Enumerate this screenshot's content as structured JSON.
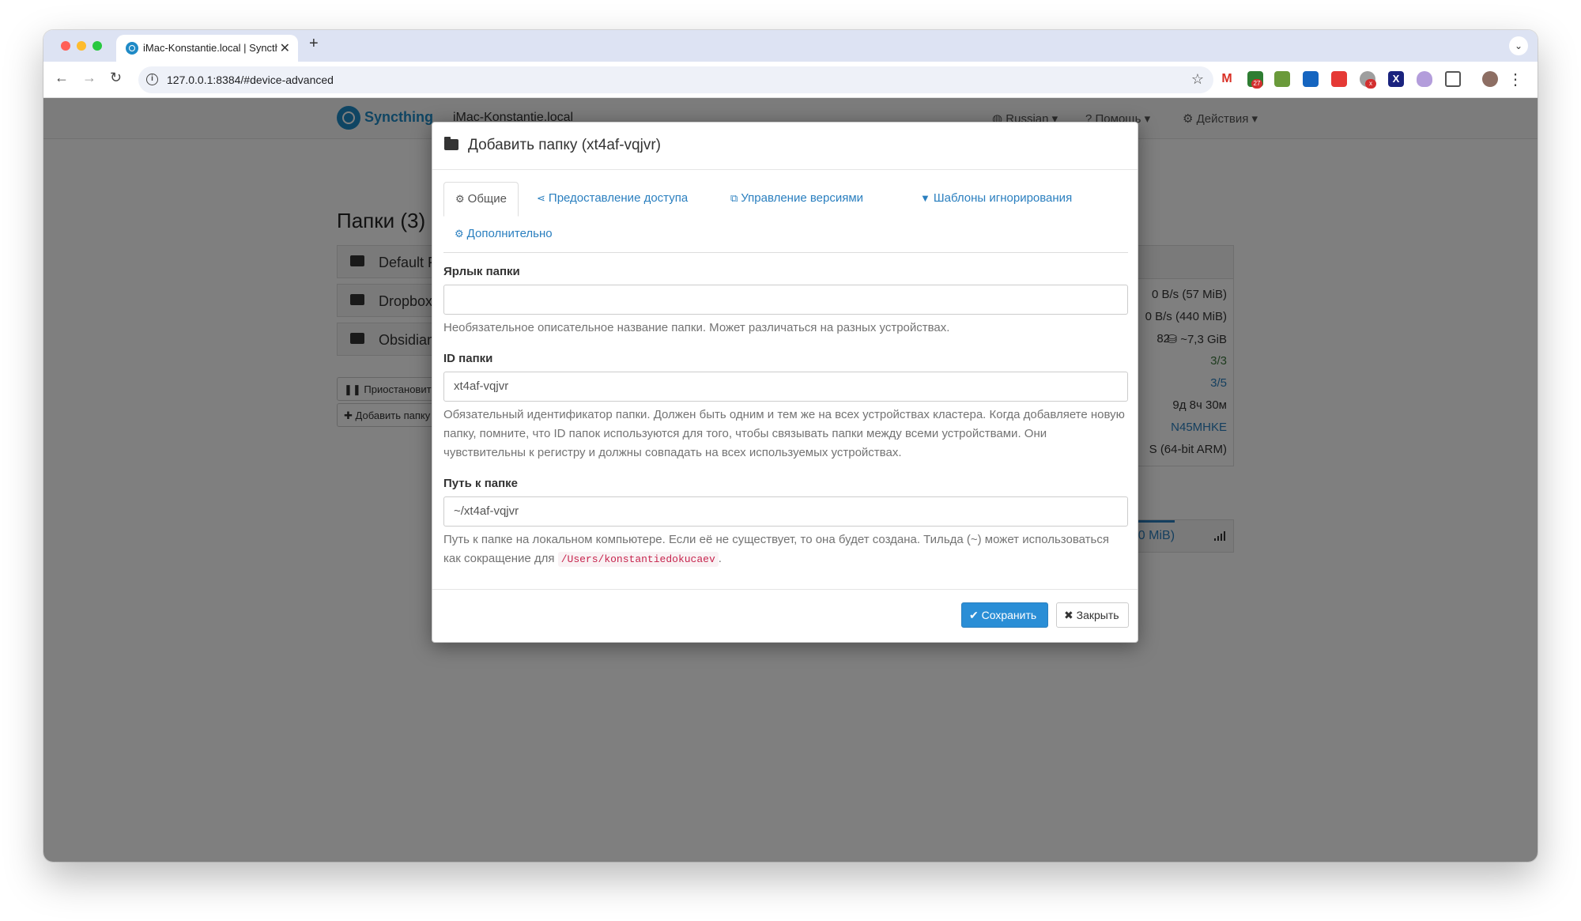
{
  "browser": {
    "tab_title": "iMac-Konstantie.local | Syncthing",
    "url": "127.0.0.1:8384/#device-advanced",
    "extension_badges": [
      "27",
      "x"
    ]
  },
  "app": {
    "brand": "Syncthing",
    "device_name": "iMac-Konstantie.local",
    "nav": {
      "language": "Russian",
      "help": "Помощь",
      "actions": "Действия"
    },
    "folders_heading": "Папки (3)",
    "folders": [
      "Default Folder",
      "Dropbox",
      "Obsidian"
    ],
    "pause_button": "Приостановить все",
    "add_folder_button": "Добавить папку",
    "device_stats": [
      "0 B/s (57 MiB)",
      "0 B/s (440 MiB)",
      "82",
      "~7,3 GiB",
      "3/3",
      "3/5",
      "9д 8ч 30м",
      "N45MHKE",
      "S (64-bit ARM)"
    ],
    "remote_transfer": "690 MiB)"
  },
  "modal": {
    "title": "Добавить папку (xt4af-vqjvr)",
    "tabs": {
      "general": "Общие",
      "sharing": "Предоставление доступа",
      "versioning": "Управление версиями",
      "ignore": "Шаблоны игнорирования",
      "advanced": "Дополнительно"
    },
    "label_field": {
      "label": "Ярлык папки",
      "value": "",
      "help": "Необязательное описательное название папки. Может различаться на разных устройствах."
    },
    "id_field": {
      "label": "ID папки",
      "value": "xt4af-vqjvr",
      "help": "Обязательный идентификатор папки. Должен быть одним и тем же на всех устройствах кластера. Когда добавляете новую папку, помните, что ID папок используются для того, чтобы связывать папки между всеми устройствами. Они чувствительны к регистру и должны совпадать на всех используемых устройствах."
    },
    "path_field": {
      "label": "Путь к папке",
      "value": "~/xt4af-vqjvr",
      "help_before": "Путь к папке на локальном компьютере. Если её не существует, то она будет создана. Тильда (~) может использоваться как сокращение для",
      "help_code": "/Users/konstantiedokucaev",
      "help_after": "."
    },
    "save_button": "Сохранить",
    "close_button": "Закрыть"
  },
  "colors": {
    "accent": "#2a7fbf",
    "primary_button": "#2a8ed6",
    "backdrop": "rgba(0,0,0,0.5)"
  }
}
